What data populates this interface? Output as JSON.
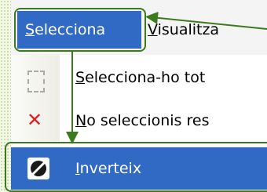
{
  "menubar": {
    "items": [
      {
        "label": "Selecciona",
        "mnemonic": "S",
        "rest": "elecciona"
      },
      {
        "label": "Visualitza",
        "mnemonic": "V",
        "rest": "isualitza"
      }
    ]
  },
  "menu": {
    "items": [
      {
        "label": "Selecciona-ho tot",
        "mnemonic": "S",
        "rest": "elecciona-ho tot",
        "icon": "select-all-icon"
      },
      {
        "label": "No seleccionis res",
        "mnemonic": "N",
        "rest": "o seleccionis res",
        "icon": "cross-icon"
      },
      {
        "label": "Inverteix",
        "mnemonic": "I",
        "rest": "nverteix",
        "icon": "invert-icon"
      }
    ]
  },
  "colors": {
    "highlight": "#316ac5",
    "callout": "#3c7a1e",
    "cross": "#e21e1e"
  }
}
